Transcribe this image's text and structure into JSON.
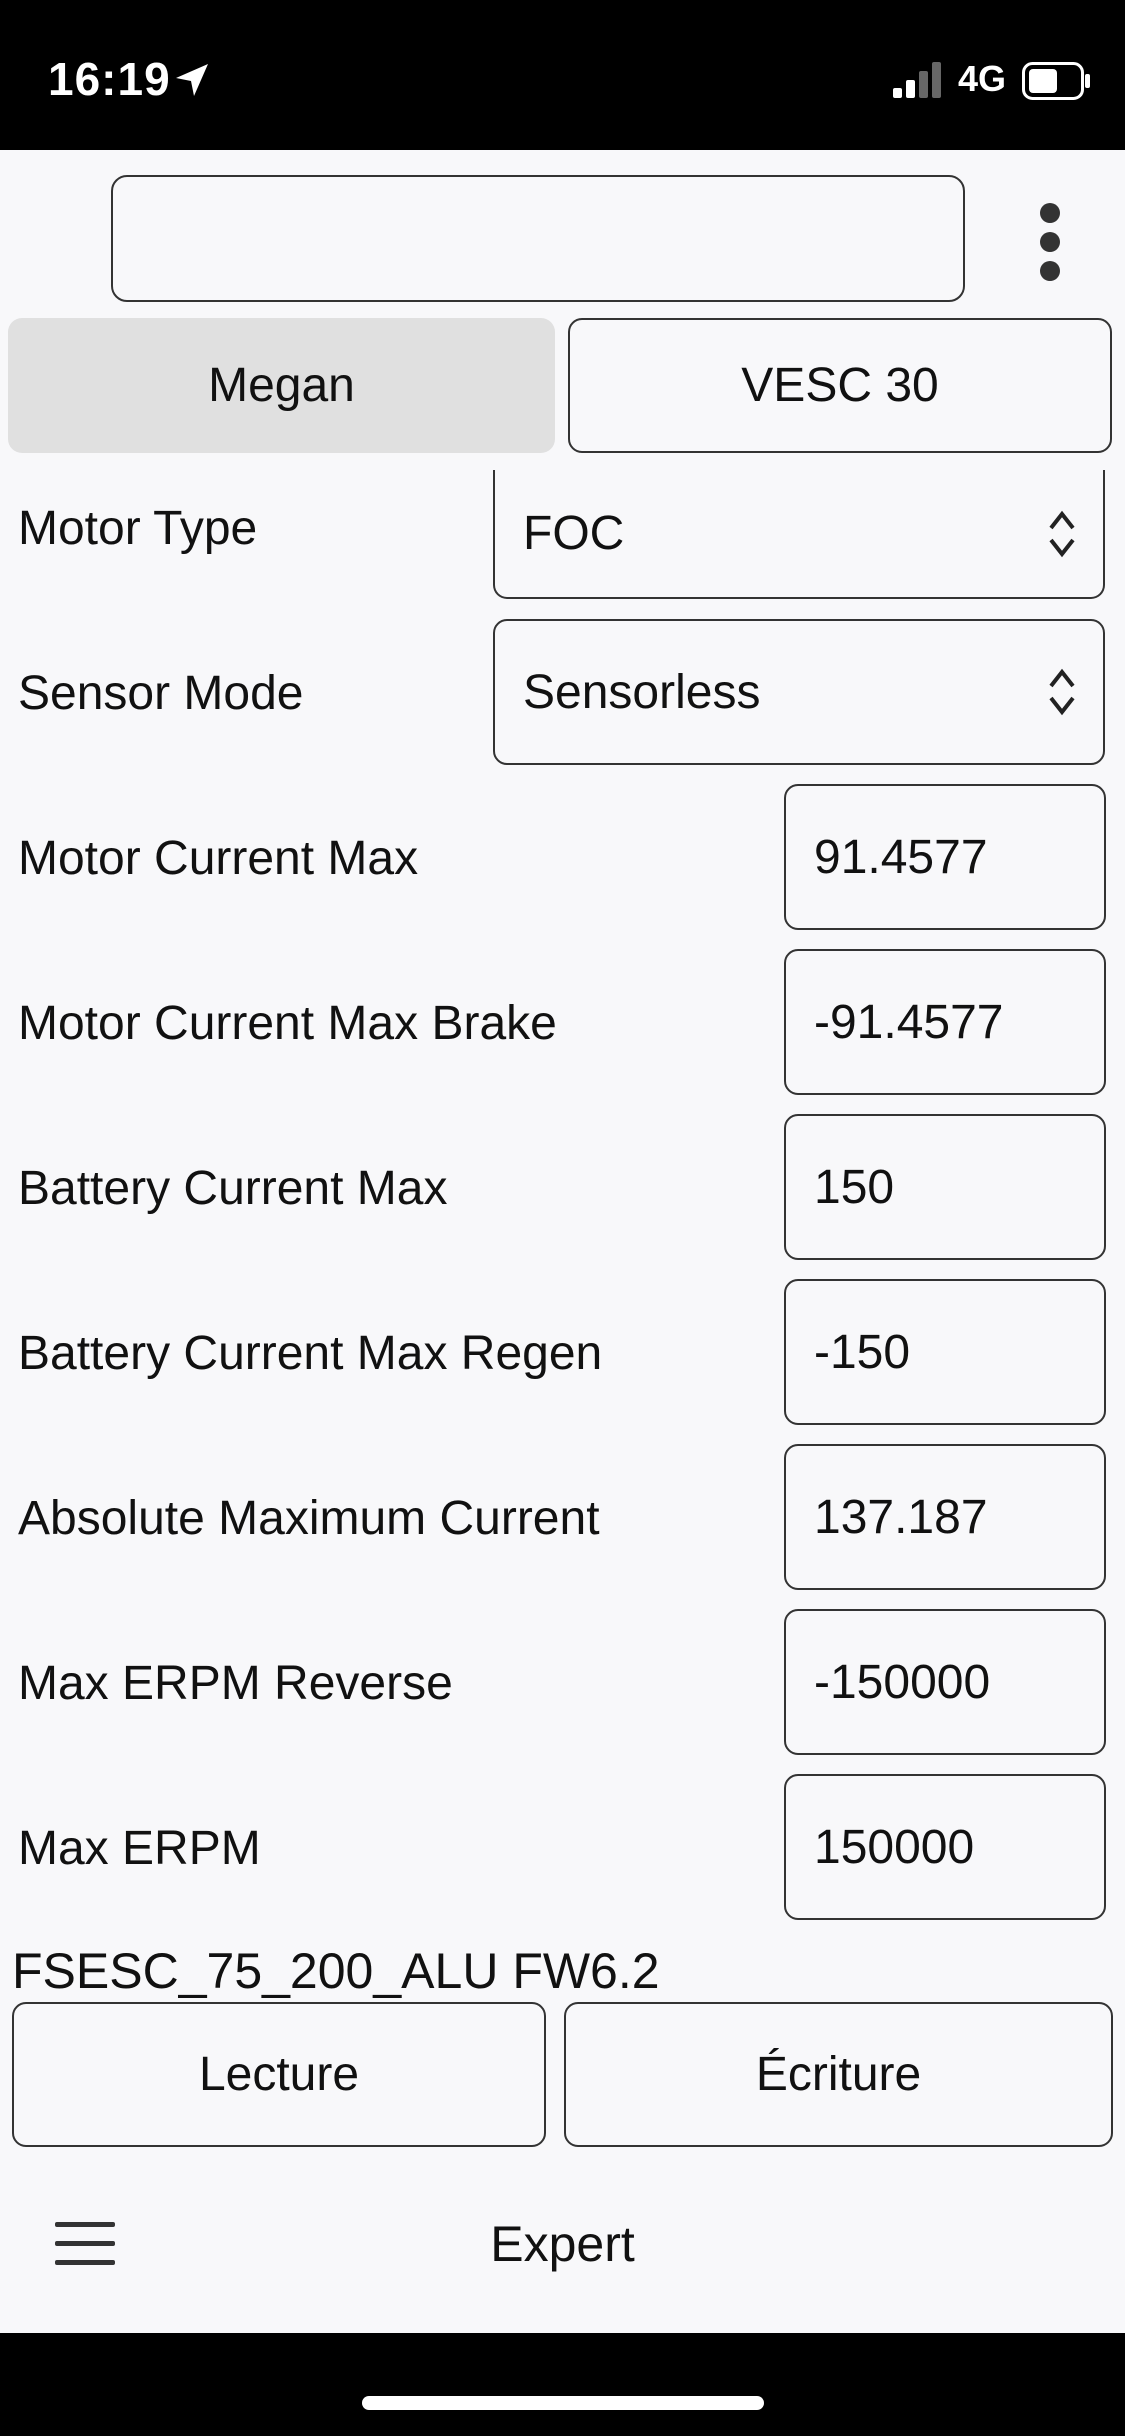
{
  "status_bar": {
    "time": "16:19",
    "network": "4G",
    "icons": [
      "location-arrow-icon",
      "signal-icon",
      "battery-icon"
    ]
  },
  "header": {
    "search_value": "",
    "menu_icon": "more-vertical-icon"
  },
  "device_tabs": [
    {
      "label": "Megan",
      "selected": true
    },
    {
      "label": "VESC 30",
      "selected": false
    }
  ],
  "settings": {
    "motor_type": {
      "label": "Motor Type",
      "value": "FOC"
    },
    "sensor_mode": {
      "label": "Sensor Mode",
      "value": "Sensorless"
    },
    "motor_current_max": {
      "label": "Motor Current Max",
      "value": "91.4577"
    },
    "motor_current_max_brake": {
      "label": "Motor Current Max Brake",
      "value": "-91.4577"
    },
    "battery_current_max": {
      "label": "Battery Current Max",
      "value": "150"
    },
    "battery_current_max_regen": {
      "label": "Battery Current Max Regen",
      "value": "-150"
    },
    "absolute_max_current": {
      "label": "Absolute Maximum Current",
      "value": "137.187"
    },
    "max_erpm_reverse": {
      "label": "Max ERPM Reverse",
      "value": "-150000"
    },
    "max_erpm": {
      "label": "Max ERPM",
      "value": "150000"
    }
  },
  "firmware": "FSESC_75_200_ALU FW6.2",
  "actions": {
    "read_label": "Lecture",
    "write_label": "Écriture"
  },
  "bottom_nav": {
    "menu_icon": "hamburger-menu-icon",
    "title": "Expert"
  },
  "colors": {
    "background": "#f8f8fa",
    "selected_tab": "#e0e0e0",
    "border": "#333333",
    "status_bar": "#000000"
  }
}
